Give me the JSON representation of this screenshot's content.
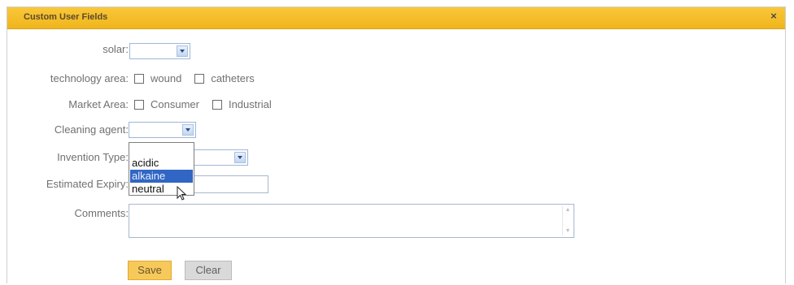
{
  "dialog": {
    "title": "Custom User Fields",
    "close_label": "×"
  },
  "fields": {
    "solar": {
      "label": "solar:"
    },
    "technology_area": {
      "label": "technology area:",
      "options": [
        "wound",
        "catheters"
      ]
    },
    "market_area": {
      "label": "Market Area:",
      "options": [
        "Consumer",
        "Industrial"
      ]
    },
    "cleaning_agent": {
      "label": "Cleaning agent:",
      "dropdown_options": [
        "acidic",
        "alkaine",
        "neutral"
      ],
      "highlighted_option": "alkaine"
    },
    "invention_type": {
      "label": "Invention Type:"
    },
    "estimated_expiry": {
      "label": "Estimated Expiry:"
    },
    "comments": {
      "label": "Comments:"
    }
  },
  "buttons": {
    "save": "Save",
    "clear": "Clear"
  },
  "colors": {
    "titlebar": "#f0b51c",
    "save_button": "#f6c95a",
    "selection": "#3166c4"
  }
}
